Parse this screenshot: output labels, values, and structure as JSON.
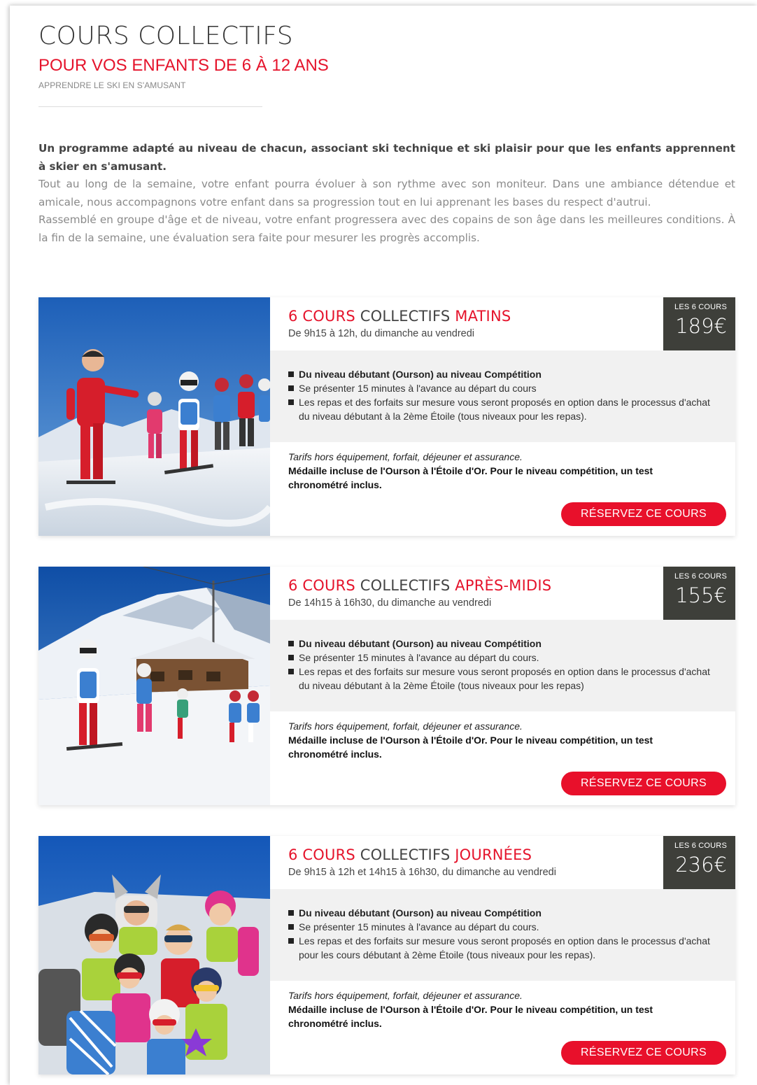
{
  "header": {
    "title": "COURS COLLECTIFS",
    "subtitle": "POUR VOS ENFANTS DE 6 À 12 ANS",
    "tagline": "APPRENDRE LE SKI EN S'AMUSANT"
  },
  "intro": {
    "lead": "Un programme adapté au niveau de chacun, associant ski technique et ski plaisir pour que les enfants apprennent à skier en s'amusant.",
    "paragraph1": "Tout au long de la semaine, votre enfant pourra évoluer à son rythme avec son moniteur. Dans une ambiance détendue et amicale, nous accompagnons votre enfant dans sa progression tout en lui apprenant les bases du respect d'autrui.",
    "paragraph2": "Rassemblé en groupe d'âge et de niveau, votre enfant progressera avec des copains de son âge dans les meilleures conditions. À la fin de la semaine, une évaluation sera faite pour mesurer les progrès accomplis."
  },
  "colors": {
    "accent": "#e5132b",
    "price_box": "#3e3f3a",
    "features_bg": "#f1f1f1"
  },
  "cards": [
    {
      "title_red": "6 COURS",
      "title_dark": " COLLECTIFS ",
      "title_highlight": "MATINS",
      "schedule": "De 9h15 à 12h, du dimanche au vendredi",
      "price_label": "LES 6 COURS",
      "price": "189€",
      "features": [
        "Du niveau débutant (Ourson) au niveau Compétition",
        "Se présenter 15 minutes à l'avance au départ du cours",
        "Les repas et des forfaits sur mesure vous seront proposés en option dans le processus d'achat du niveau débutant à la 2ème Étoile (tous niveaux pour les repas)."
      ],
      "note_italic": "Tarifs hors équipement, forfait, déjeuner et assurance.",
      "note_bold": "Médaille incluse de l'Ourson à l'Étoile d'Or. Pour le niveau compétition, un test chronométré inclus.",
      "button": "RÉSERVEZ CE COURS",
      "photo": "ski-instructor-with-children"
    },
    {
      "title_red": "6 COURS",
      "title_dark": " COLLECTIFS ",
      "title_highlight": "APRÈS-MIDIS",
      "schedule": "De 14h15 à 16h30, du dimanche au vendredi",
      "price_label": "LES 6 COURS",
      "price": "155€",
      "features": [
        "Du niveau débutant (Ourson) au niveau Compétition",
        "Se présenter 15 minutes à l'avance au départ du cours.",
        "Les repas et des forfaits sur mesure vous seront proposés en option dans le processus d'achat du niveau débutant à la 2ème Étoile (tous niveaux pour les repas)"
      ],
      "note_italic": "Tarifs hors équipement, forfait, déjeuner et assurance.",
      "note_bold": "Médaille incluse de l'Ourson à l'Étoile d'Or. Pour le niveau compétition, un test chronométré inclus.",
      "button": "RÉSERVEZ CE COURS",
      "photo": "children-skiing-near-chalet"
    },
    {
      "title_red": "6 COURS",
      "title_dark": " COLLECTIFS ",
      "title_highlight": "JOURNÉES",
      "schedule": "De 9h15 à 12h et 14h15 à 16h30, du dimanche au vendredi",
      "price_label": "LES 6 COURS",
      "price": "236€",
      "features": [
        "Du niveau débutant (Ourson) au niveau Compétition",
        "Se présenter 15 minutes à l'avance au départ du cours.",
        "Les repas et des forfaits sur mesure vous seront proposés en option dans le processus d'achat pour les cours débutant à 2ème Étoile (tous niveaux pour les repas)."
      ],
      "note_italic": "Tarifs hors équipement, forfait, déjeuner et assurance.",
      "note_bold": "Médaille incluse de l'Ourson à l'Étoile d'Or. Pour le niveau compétition, un test chronométré inclus.",
      "button": "RÉSERVEZ CE COURS",
      "photo": "group-of-kids-with-helmets"
    }
  ]
}
